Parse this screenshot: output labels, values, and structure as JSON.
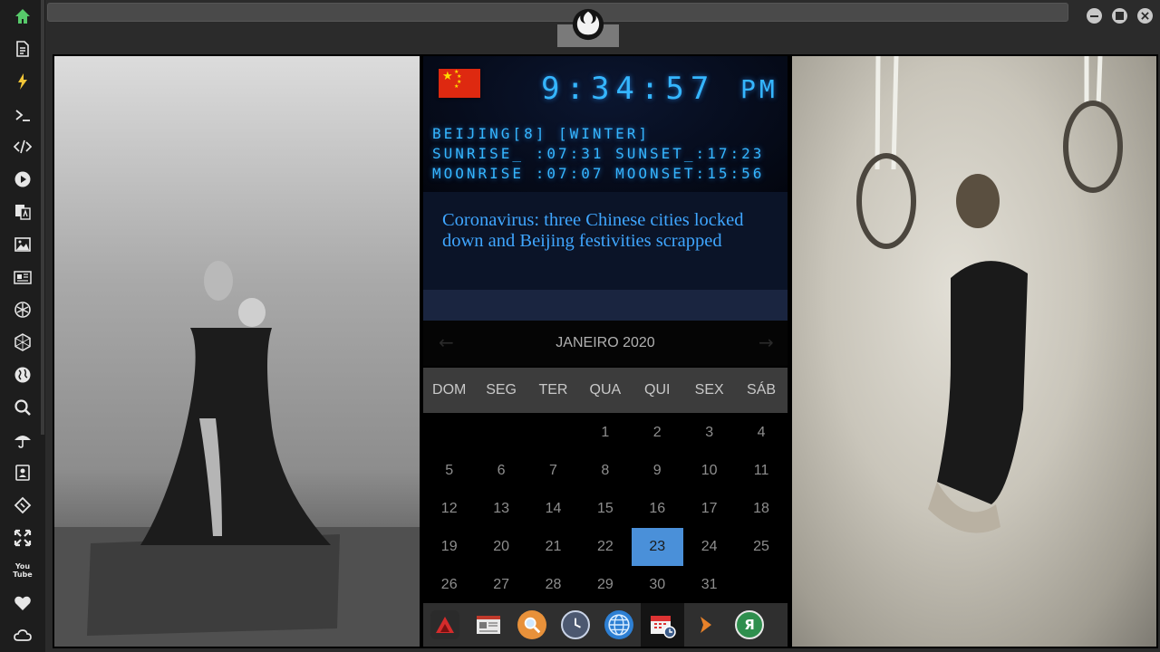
{
  "sidebar": {
    "icons": [
      "home-icon",
      "document-icon",
      "lightning-icon",
      "terminal-icon",
      "code-icon",
      "play-icon",
      "translate-icon",
      "image-icon",
      "newspaper-icon",
      "rebel-alliance-icon",
      "hexagon-icon",
      "globe-icon",
      "search-icon",
      "umbrella-icon",
      "contact-book-icon",
      "tag-code-icon",
      "expand-icon",
      "youtube-icon",
      "heart-icon",
      "cloud-icon"
    ],
    "accent": "#57c96a",
    "youtube_label": "You Tube"
  },
  "clock": {
    "time": "9:34:57",
    "ampm": "PM",
    "line1": "BEIJING[8] [WINTER]",
    "line2": "SUNRISE_ :07:31 SUNSET_:17:23",
    "line3": "MOONRISE :07:07 MOONSET:15:56",
    "color": "#35b6ff"
  },
  "news": {
    "headline": "Coronavirus: three Chinese cities locked down and Beijing festivities scrapped"
  },
  "calendar": {
    "month_label": "JANEIRO 2020",
    "weekdays": [
      "DOM",
      "SEG",
      "TER",
      "QUA",
      "QUI",
      "SEX",
      "SÁB"
    ],
    "weeks": [
      [
        "",
        "",
        "",
        "1",
        "2",
        "3",
        "4"
      ],
      [
        "5",
        "6",
        "7",
        "8",
        "9",
        "10",
        "11"
      ],
      [
        "12",
        "13",
        "14",
        "15",
        "16",
        "17",
        "18"
      ],
      [
        "19",
        "20",
        "21",
        "22",
        "23",
        "24",
        "25"
      ],
      [
        "26",
        "27",
        "28",
        "29",
        "30",
        "31",
        ""
      ]
    ],
    "today": "23",
    "today_color": "#4a90d9"
  },
  "dock": {
    "items": [
      "app-launcher-icon",
      "news-reader-icon",
      "search-icon",
      "clock-icon",
      "browser-globe-icon",
      "calendar-icon",
      "arrow-app-icon",
      "yandex-icon"
    ],
    "yandex_label": "Я"
  }
}
